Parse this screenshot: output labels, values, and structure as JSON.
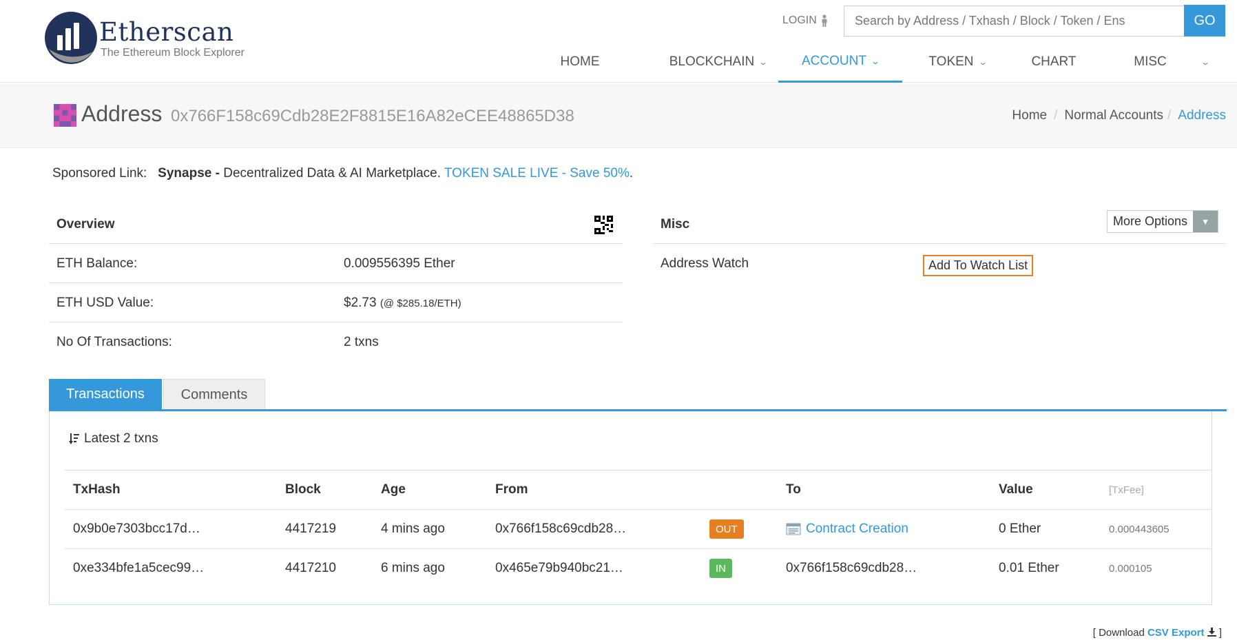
{
  "brand": {
    "name": "Etherscan",
    "tagline": "The Ethereum Block Explorer",
    "color": "#21325b"
  },
  "header": {
    "login_label": "LOGIN",
    "search_placeholder": "Search by Address / Txhash / Block / Token / Ens",
    "go_label": "GO",
    "nav": [
      {
        "label": "HOME",
        "dropdown": false,
        "active": false
      },
      {
        "label": "BLOCKCHAIN",
        "dropdown": true,
        "active": false
      },
      {
        "label": "ACCOUNT",
        "dropdown": true,
        "active": true
      },
      {
        "label": "TOKEN",
        "dropdown": true,
        "active": false
      },
      {
        "label": "CHART",
        "dropdown": false,
        "active": false
      },
      {
        "label": "MISC",
        "dropdown": false,
        "active": false
      }
    ],
    "accent": "#3498db"
  },
  "page": {
    "title": "Address",
    "address": "0x766F158c69Cdb28E2F8815E16A82eCEE48865D38",
    "breadcrumb": {
      "home": "Home",
      "section": "Normal Accounts",
      "current": "Address"
    }
  },
  "sponsored": {
    "prefix": "Sponsored Link:",
    "brand": "Synapse -",
    "text": "Decentralized Data & AI Marketplace.",
    "link": "TOKEN SALE LIVE - Save 50%",
    "suffix": "."
  },
  "overview": {
    "title": "Overview",
    "rows": [
      {
        "label": "ETH Balance:",
        "value": "0.009556395 Ether",
        "note": ""
      },
      {
        "label": "ETH USD Value:",
        "value": "$2.73",
        "note": "(@ $285.18/ETH)"
      },
      {
        "label": "No Of Transactions:",
        "value": "2 txns",
        "note": ""
      }
    ]
  },
  "misc": {
    "title": "Misc",
    "more_options_label": "More Options",
    "watch_label": "Address Watch",
    "watch_button": "Add To Watch List"
  },
  "tabs": {
    "transactions": "Transactions",
    "comments": "Comments"
  },
  "transactions": {
    "summary": "Latest 2 txns",
    "columns": {
      "hash": "TxHash",
      "block": "Block",
      "age": "Age",
      "from": "From",
      "to": "To",
      "value": "Value",
      "fee": "[TxFee]"
    },
    "rows": [
      {
        "hash": "0x9b0e7303bcc17d…",
        "block": "4417219",
        "age": "4 mins ago",
        "from": "0x766f158c69cdb28…",
        "from_is_link": false,
        "direction": "OUT",
        "to": "Contract Creation",
        "to_is_link": true,
        "value": "0 Ether",
        "fee": "0.000443605"
      },
      {
        "hash": "0xe334bfe1a5cec99…",
        "block": "4417210",
        "age": "6 mins ago",
        "from": "0x465e79b940bc21…",
        "from_is_link": true,
        "direction": "IN",
        "to": "0x766f158c69cdb28…",
        "to_is_link": false,
        "value": "0.01 Ether",
        "fee": "0.000105"
      }
    ],
    "download_prefix": "[ Download",
    "download_link": "CSV Export",
    "download_suffix": "]",
    "out_color": "#e67e22",
    "in_color": "#5cb85c"
  }
}
